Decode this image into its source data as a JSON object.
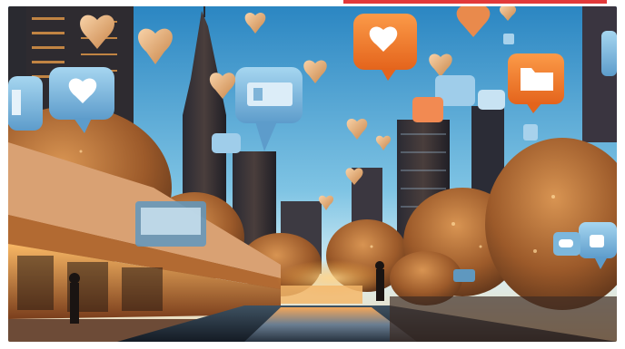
{
  "image": {
    "kind": "ai-generated illustration",
    "palette": {
      "sky_top": "#2f8fc8",
      "sky_horizon": "#bfe6f3",
      "warm_glow": "#f39a3b",
      "bubble_orange": "#f07a2a",
      "bubble_blue": "#7cb7dc",
      "shrub": "#a9642f"
    },
    "icons": [
      "heart-icon",
      "folder-icon",
      "image-icon",
      "chat-bubble-icon"
    ]
  }
}
